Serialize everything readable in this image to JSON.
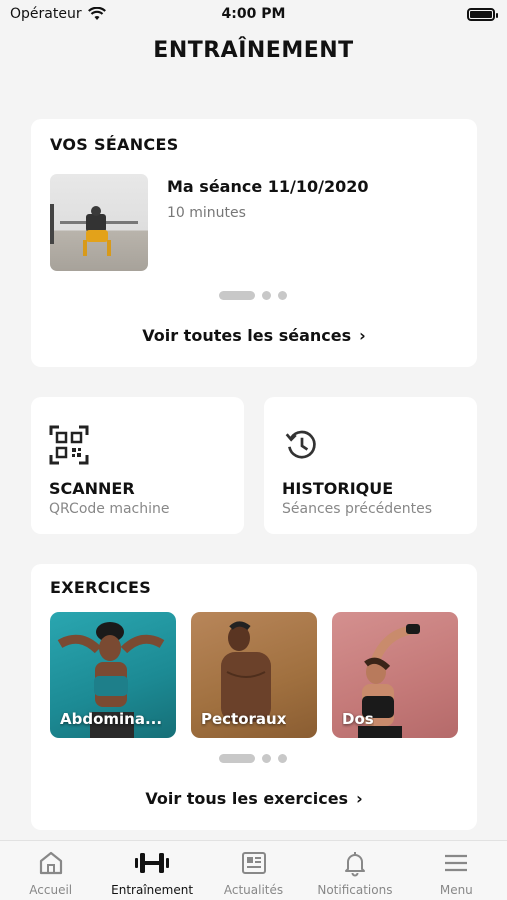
{
  "status": {
    "carrier": "Opérateur",
    "time": "4:00 PM"
  },
  "header": {
    "title": "ENTRAÎNEMENT"
  },
  "seances": {
    "heading": "VOS SÉANCES",
    "item": {
      "title": "Ma séance 11/10/2020",
      "subtitle": "10 minutes"
    },
    "link": "Voir toutes les séances"
  },
  "tiles": {
    "scanner": {
      "title": "SCANNER",
      "subtitle": "QRCode machine",
      "icon": "qr-code-icon"
    },
    "historique": {
      "title": "HISTORIQUE",
      "subtitle": "Séances précédentes",
      "icon": "history-icon"
    }
  },
  "exercices": {
    "heading": "EXERCICES",
    "items": [
      {
        "label": "Abdomina..."
      },
      {
        "label": "Pectoraux"
      },
      {
        "label": "Dos"
      }
    ],
    "link": "Voir tous les exercices"
  },
  "tabbar": {
    "items": [
      {
        "label": "Accueil",
        "icon": "home-icon"
      },
      {
        "label": "Entraînement",
        "icon": "dumbbell-icon"
      },
      {
        "label": "Actualités",
        "icon": "news-icon"
      },
      {
        "label": "Notifications",
        "icon": "bell-icon"
      },
      {
        "label": "Menu",
        "icon": "menu-icon"
      }
    ],
    "active_index": 1
  },
  "colors": {
    "background": "#f4f4f4",
    "card": "#ffffff",
    "text": "#111111",
    "muted": "#888888",
    "dots": "#c8c8c8"
  }
}
